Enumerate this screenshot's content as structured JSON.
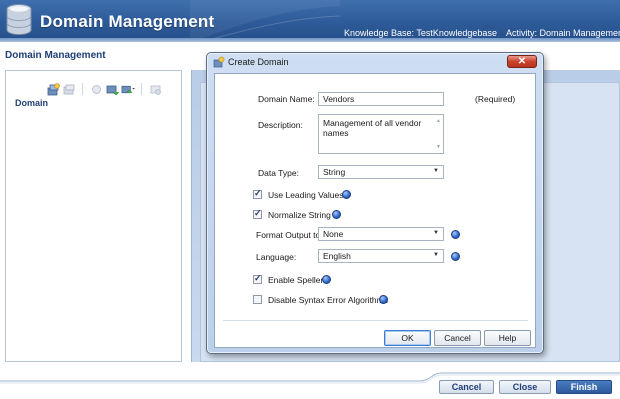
{
  "header": {
    "title": "Domain Management",
    "knowledge_base": "Knowledge Base: TestKnowledgebase",
    "activity": "Activity: Domain Management"
  },
  "page": {
    "title": "Domain Management",
    "domain_column": "Domain",
    "toolbar_icons": [
      "create-domain-icon",
      "create-composite-domain-icon",
      "delete-domain-icon",
      "import-domain-icon",
      "export-domain-icon",
      "view-icon"
    ]
  },
  "dialog": {
    "title": "Create Domain",
    "close_label": "✕",
    "domain_name_label": "Domain Name:",
    "domain_name_value": "Vendors",
    "required_label": "(Required)",
    "description_label": "Description:",
    "description_value": "Management of all vendor names",
    "data_type_label": "Data Type:",
    "data_type_value": "String",
    "use_leading_values_label": "Use Leading Values",
    "use_leading_values_checked": true,
    "normalize_string_label": "Normalize String",
    "normalize_string_checked": true,
    "format_output_label": "Format Output to:",
    "format_output_value": "None",
    "language_label": "Language:",
    "language_value": "English",
    "enable_speller_label": "Enable Speller",
    "enable_speller_checked": true,
    "disable_syntax_label": "Disable Syntax Error Algorithms",
    "disable_syntax_checked": false,
    "ok_label": "OK",
    "cancel_label": "Cancel",
    "help_label": "Help"
  },
  "footer": {
    "cancel_label": "Cancel",
    "close_label": "Close",
    "finish_label": "Finish"
  },
  "colors": {
    "header_blue": "#2d5a98",
    "accent_blue": "#1f3f77",
    "dialog_frame": "#bcd0ea"
  }
}
